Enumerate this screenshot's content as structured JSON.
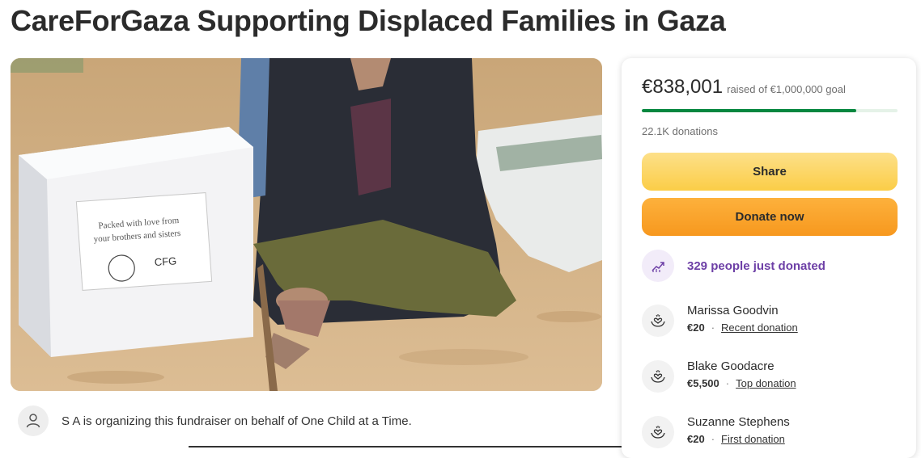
{
  "page": {
    "title": "CareForGaza Supporting Displaced Families in Gaza"
  },
  "hero": {
    "box_line1": "Packed with love from",
    "box_line2": "your brothers and sisters",
    "box_logo": "CFG"
  },
  "organizer": {
    "text": "S A is organizing this fundraiser on behalf of One Child at a Time."
  },
  "card": {
    "amount": "€838,001",
    "goal": "raised of €1,000,000 goal",
    "progress_fraction": 0.838,
    "donations": "22.1K donations",
    "share_label": "Share",
    "donate_label": "Donate now",
    "momentum": "329 people just donated",
    "donors": [
      {
        "name": "Marissa Goodvin",
        "amount": "€20",
        "tag": "Recent donation"
      },
      {
        "name": "Blake Goodacre",
        "amount": "€5,500",
        "tag": "Top donation"
      },
      {
        "name": "Suzanne Stephens",
        "amount": "€20",
        "tag": "First donation"
      }
    ]
  },
  "colors": {
    "progress": "#06873f",
    "share": "#fbcd47",
    "donate": "#f7981e",
    "momentum": "#6d3fa6"
  },
  "icons": {
    "organizer": "user-icon",
    "momentum": "trending-up-icon",
    "donor": "heart-hands-icon"
  }
}
